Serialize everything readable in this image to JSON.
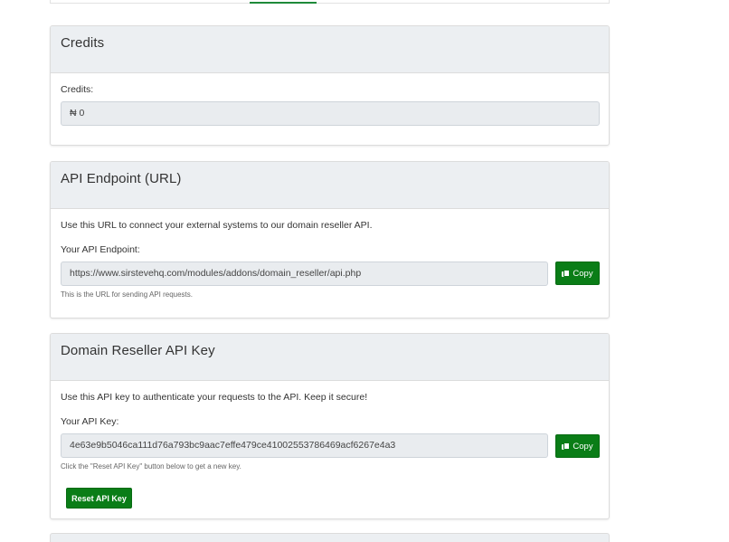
{
  "credits_card": {
    "title": "Credits",
    "label": "Credits:",
    "value": "₦ 0"
  },
  "endpoint_card": {
    "title": "API Endpoint (URL)",
    "description": "Use this URL to connect your external systems to our domain reseller API.",
    "label": "Your API Endpoint:",
    "value": "https://www.sirstevehq.com/modules/addons/domain_reseller/api.php",
    "help": "This is the URL for sending API requests.",
    "copy_label": "Copy"
  },
  "apikey_card": {
    "title": "Domain Reseller API Key",
    "description": "Use this API key to authenticate your requests to the API. Keep it secure!",
    "label": "Your API Key:",
    "value": "4e63e9b5046ca111d76a793bc9aac7effe479ce41002553786469acf6267e4a3",
    "help": "Click the \"Reset API Key\" button below to get a new key.",
    "copy_label": "Copy",
    "reset_label": "Reset API Key"
  },
  "colors": {
    "button_green": "#0a7d17",
    "header_bg": "#eceff2",
    "field_bg": "#e9ecef"
  }
}
